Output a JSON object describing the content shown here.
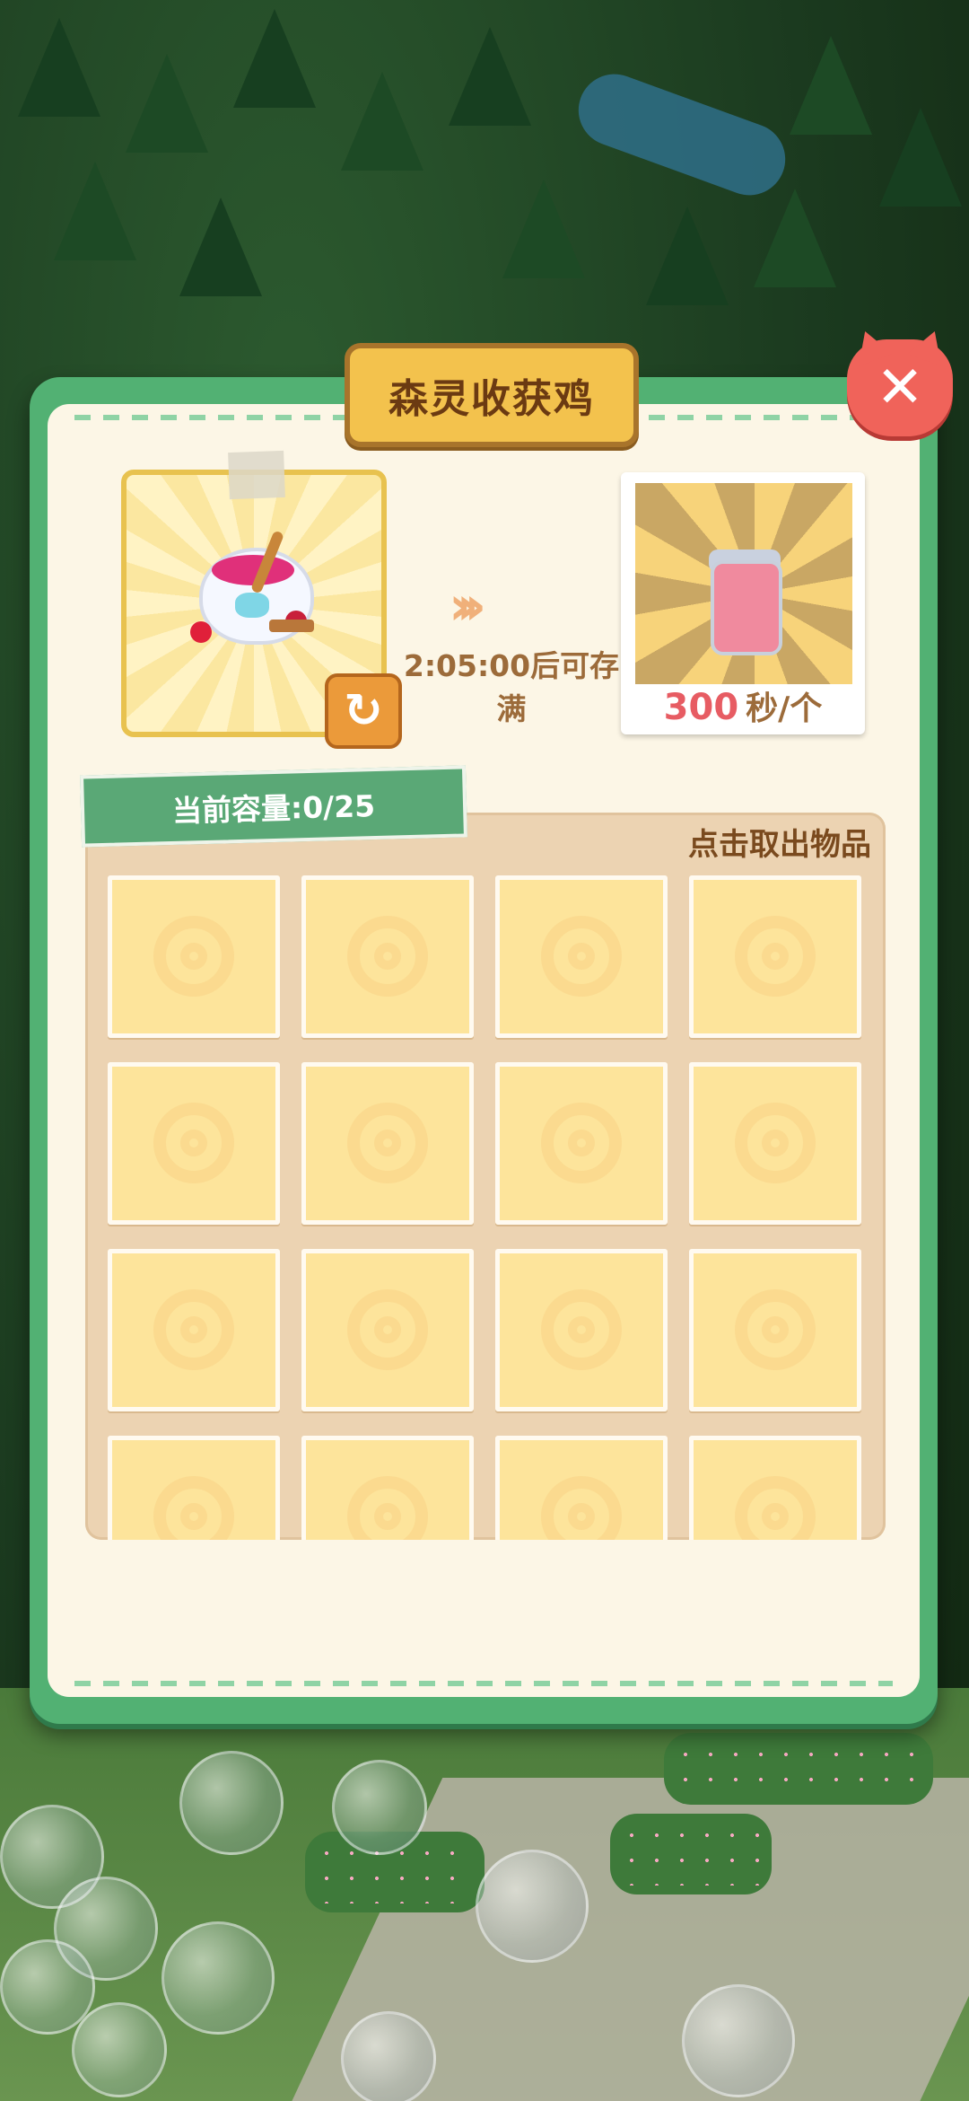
{
  "dialog": {
    "title": "森灵收获鸡",
    "close_icon": "close-x-icon",
    "refresh_icon": "refresh-icon",
    "fill_time_text": "2:05:00后可存满",
    "production": {
      "rate_value": "300",
      "rate_unit": "秒/个"
    },
    "capacity_text": "当前容量:0/25",
    "storage_hint": "点击取出物品",
    "slots": [
      "",
      "",
      "",
      "",
      "",
      "",
      "",
      "",
      "",
      "",
      "",
      "",
      "",
      "",
      "",
      ""
    ]
  },
  "colors": {
    "panel_green": "#52b173",
    "banner_gold": "#f3c24d",
    "close_red": "#f0635a",
    "rate_red": "#e75c63",
    "slot_yellow": "#fde49b"
  }
}
